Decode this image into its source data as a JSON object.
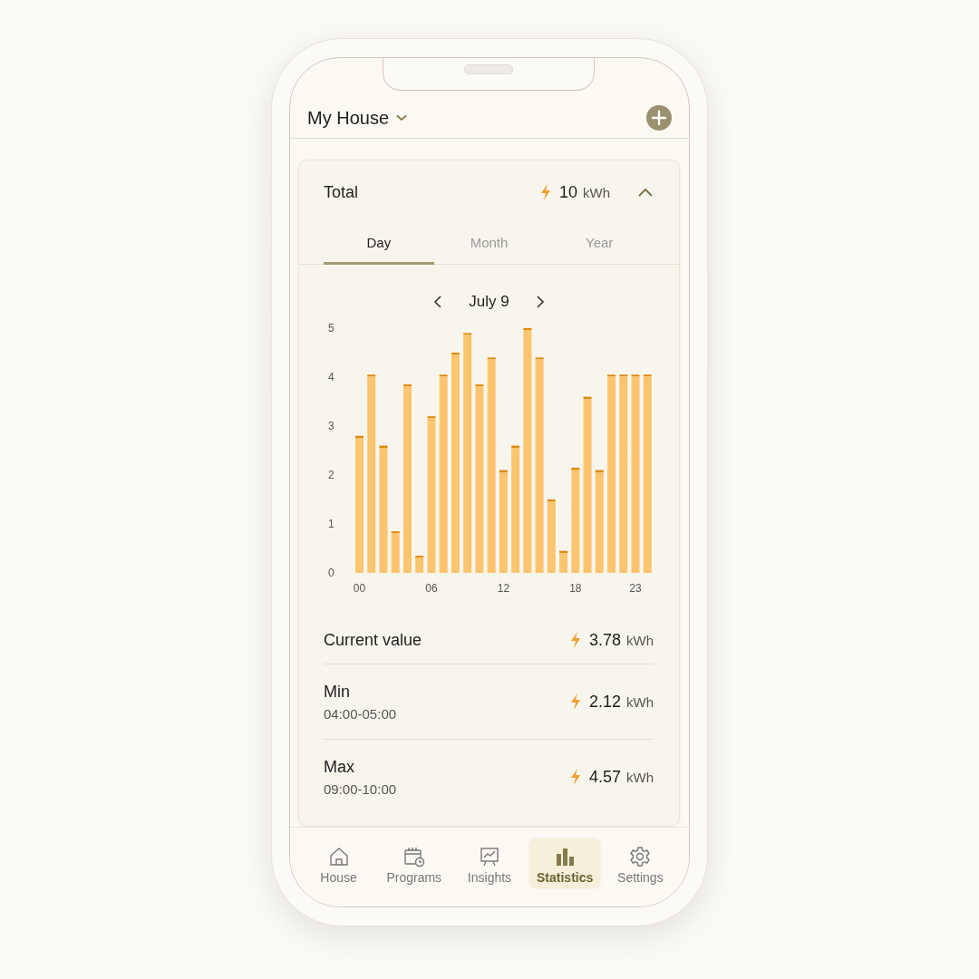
{
  "header": {
    "title": "My House"
  },
  "total": {
    "label": "Total",
    "value": "10",
    "unit": "kWh",
    "expanded": true
  },
  "tabs": [
    {
      "label": "Day",
      "selected": true
    },
    {
      "label": "Month",
      "selected": false
    },
    {
      "label": "Year",
      "selected": false
    }
  ],
  "date": "July 9",
  "chart_data": {
    "type": "bar",
    "x": [
      0,
      1,
      2,
      3,
      4,
      5,
      6,
      7,
      8,
      9,
      10,
      11,
      12,
      13,
      14,
      15,
      16,
      17,
      18,
      19,
      20,
      21,
      22,
      23,
      24
    ],
    "xlim": [
      -0.5,
      24.5
    ],
    "series": [
      {
        "color": "#fbc46e",
        "values": [
          2.8,
          4.05,
          2.6,
          0.85,
          3.85,
          0.35,
          3.2,
          4.05,
          4.5,
          4.9,
          3.85,
          4.4,
          2.1,
          2.6,
          5.0,
          4.4,
          1.5,
          0.45,
          2.15,
          3.6,
          2.1,
          4.05,
          4.05,
          4.05,
          4.05
        ]
      }
    ],
    "ylim": [
      0,
      5
    ],
    "yticks": [
      0,
      1,
      2,
      3,
      4,
      5
    ],
    "xticks": [
      {
        "value": 0,
        "label": "00"
      },
      {
        "value": 6,
        "label": "06"
      },
      {
        "value": 12,
        "label": "12"
      },
      {
        "value": 18,
        "label": "18"
      },
      {
        "value": 23,
        "label": "23"
      }
    ]
  },
  "stats": [
    {
      "label": "Current value",
      "value": "3.78",
      "unit": "kWh"
    },
    {
      "label": "Min",
      "sub": "04:00-05:00",
      "value": "2.12",
      "unit": "kWh"
    },
    {
      "label": "Max",
      "sub": "09:00-10:00",
      "value": "4.57",
      "unit": "kWh"
    }
  ],
  "nav": [
    {
      "label": "House",
      "kind": "house",
      "selected": false
    },
    {
      "label": "Programs",
      "kind": "calendar",
      "selected": false
    },
    {
      "label": "Insights",
      "kind": "board",
      "selected": false
    },
    {
      "label": "Statistics",
      "kind": "bars",
      "selected": true
    },
    {
      "label": "Settings",
      "kind": "gear",
      "selected": false
    }
  ]
}
